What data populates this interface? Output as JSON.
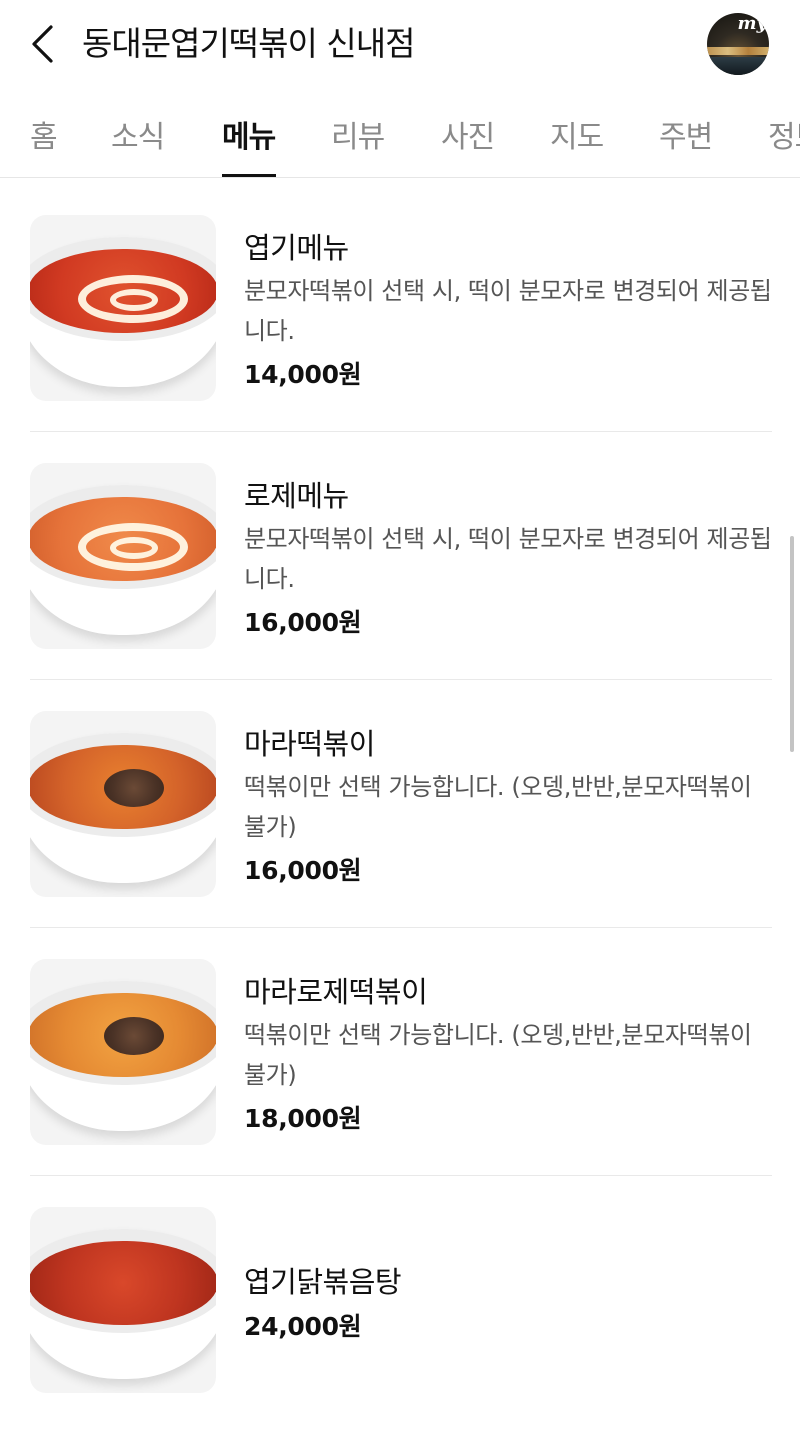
{
  "header": {
    "title": "동대문엽기떡볶이 신내점",
    "avatar_label": "my"
  },
  "tabs": [
    {
      "label": "홈"
    },
    {
      "label": "소식"
    },
    {
      "label": "메뉴",
      "active": true
    },
    {
      "label": "리뷰"
    },
    {
      "label": "사진"
    },
    {
      "label": "지도"
    },
    {
      "label": "주변"
    },
    {
      "label": "정보"
    }
  ],
  "menu": [
    {
      "name": "엽기메뉴",
      "desc": "분모자떡볶이 선택 시, 떡이 분모자로 변경되어 제공됩니다.",
      "price": "14,000원"
    },
    {
      "name": "로제메뉴",
      "desc": "분모자떡볶이 선택 시, 떡이 분모자로 변경되어 제공됩니다.",
      "price": "16,000원"
    },
    {
      "name": "마라떡볶이",
      "desc": "떡볶이만 선택 가능합니다. (오뎅,반반,분모자떡볶이 불가)",
      "price": "16,000원"
    },
    {
      "name": "마라로제떡볶이",
      "desc": "떡볶이만 선택 가능합니다. (오뎅,반반,분모자떡볶이 불가)",
      "price": "18,000원"
    },
    {
      "name": "엽기닭볶음탕",
      "desc": "",
      "price": "24,000원"
    }
  ],
  "colors": {
    "accent": "#111111",
    "muted_text": "#555555",
    "tab_inactive": "#8a8a8a"
  }
}
